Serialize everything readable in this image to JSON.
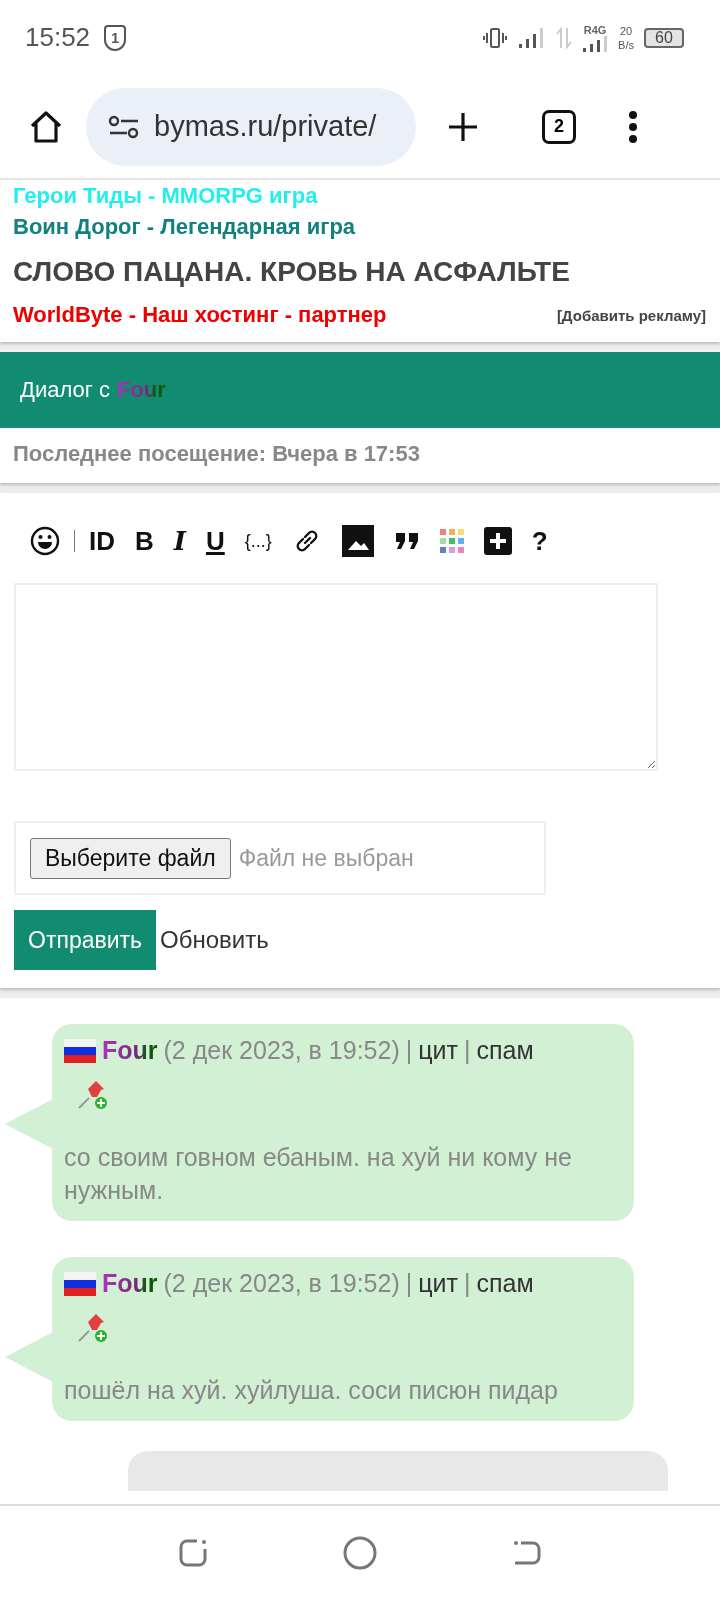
{
  "status_bar": {
    "time": "15:52",
    "notification_count": "1",
    "network": "R4G",
    "speed_value": "20",
    "speed_unit": "B/s",
    "battery": "60"
  },
  "browser": {
    "url": "bymas.ru/private/",
    "tab_count": "2"
  },
  "ads": [
    {
      "text": "Герои Тиды - MMORPG игра",
      "color": "#22eeee"
    },
    {
      "text": "Воин Дорог - Легендарная игра",
      "color": "#118080"
    },
    {
      "text": "СЛОВО ПАЦАНА. КРОВЬ НА АСФАЛЬТЕ",
      "color": "#444444"
    },
    {
      "text": "WorldByte - Наш хостинг - партнер",
      "color": "#ee0000"
    }
  ],
  "add_ad_link": "[Добавить рекламу]",
  "dialog": {
    "title_prefix": "Диалог с",
    "contact": "Four",
    "last_visit": "Последнее посещение: Вчера в 17:53"
  },
  "toolbar": [
    {
      "kind": "smile"
    },
    {
      "kind": "separator"
    },
    {
      "kind": "text",
      "label": "ID"
    },
    {
      "kind": "bold",
      "label": "B"
    },
    {
      "kind": "italic",
      "label": "I"
    },
    {
      "kind": "underline",
      "label": "U"
    },
    {
      "kind": "code",
      "label": "{...}"
    },
    {
      "kind": "link"
    },
    {
      "kind": "image"
    },
    {
      "kind": "quote"
    },
    {
      "kind": "palette"
    },
    {
      "kind": "plus"
    },
    {
      "kind": "text",
      "label": "?"
    }
  ],
  "file_input": {
    "button": "Выберите файл",
    "status": "Файл не выбран"
  },
  "buttons": {
    "send": "Отправить",
    "refresh": "Обновить"
  },
  "messages": [
    {
      "kind": "incoming",
      "author": "Four",
      "date": "(2 дек 2023, в 19:52)",
      "separator": "|",
      "actions": [
        "цит",
        "спам"
      ],
      "text": "со своим говном ебаным. на хуй ни кому не нужным."
    },
    {
      "kind": "incoming",
      "author": "Four",
      "date": "(2 дек 2023, в 19:52)",
      "separator": "|",
      "actions": [
        "цит",
        "спам"
      ],
      "text": "пошёл на хуй. хуйлуша. соси писюн пидар"
    },
    {
      "kind": "outgoing"
    }
  ]
}
